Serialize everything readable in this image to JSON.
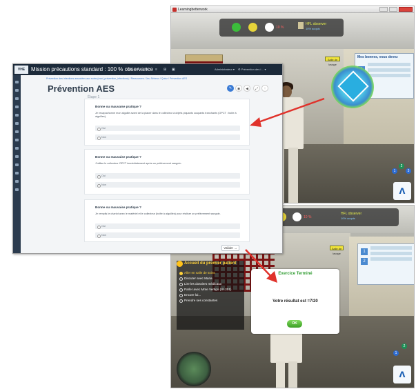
{
  "game_top": {
    "window_title": "Learningbetterwork",
    "hud": {
      "percent": "10 %",
      "player_name": "HFL observer",
      "player_sub": "10% acquis"
    },
    "sign": "Salle de lavage",
    "poster_heading": "Mes bonnes, vous devez"
  },
  "webapp": {
    "brand": "VHE",
    "title": "Mission précautions standard : 100 % observance",
    "top_icons": [
      "A",
      "A",
      "A-",
      "≡",
      "⊞",
      "▣"
    ],
    "user_menu": "Administrateur ▾",
    "user_menu2": "⚙ Prévention des i… ▾",
    "breadcrumb": "Prévention des infections associées aux soins (mod_prévention_infections)  /  Ressources  /  Jeu-Sérieux  /  Quizz  /  Prévention AES",
    "page_title": "Prévention AES",
    "etape": "Étape 1",
    "cards": [
      {
        "heading": "Bonne ou mauvaise pratique ?",
        "question": "Je recapuchonne mon aiguille avant de la placer dans le collecteur à objets piquants coupants tranchants (OPCT : boîte à aiguilles).",
        "options": [
          "Oui",
          "Non"
        ]
      },
      {
        "heading": "Bonne ou mauvaise pratique ?",
        "question": "J'utilise le collecteur OPCT immédiatement après un prélèvement sanguin.",
        "options": [
          "Oui",
          "Non"
        ]
      },
      {
        "heading": "Bonne ou mauvaise pratique ?",
        "question": "Je remplis le chariot avec le matériel et le collecteur (boîte à aiguilles) pour réaliser un prélèvement sanguin.",
        "options": [
          "Oui",
          "Non"
        ]
      }
    ],
    "submit_label": "Valider →"
  },
  "game_bot": {
    "hud": {
      "percent": "10 %",
      "player_name": "HFL observer",
      "player_sub": "10% acquis"
    },
    "quest_title": "Accueil du premier patient",
    "quest_items": [
      {
        "label": "Aller en salle de soins",
        "done": true
      },
      {
        "label": "Discuter avec Maria",
        "done": false
      },
      {
        "label": "Lire les dossiers médicaux",
        "done": false
      },
      {
        "label": "Parler avec Mme Vertigo (ch.201)",
        "done": false
      },
      {
        "label": "Encore lui...",
        "done": false
      },
      {
        "label": "Prendre ses constantes",
        "done": false
      }
    ],
    "popup_title": "Exercice Terminé",
    "popup_result": "Votre résultat est =7/20",
    "ok_label": "OK"
  },
  "colors": {
    "arrow": "#e0322b",
    "accent_blue": "#3a7bd5",
    "popup_green": "#2f9c31",
    "topbar": "#1c2a3a"
  }
}
